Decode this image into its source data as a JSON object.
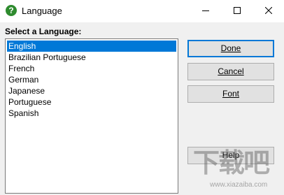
{
  "window": {
    "title": "Language",
    "icon": "question-mark-icon",
    "controls": [
      "minimize",
      "maximize",
      "close"
    ]
  },
  "prompt": "Select a Language:",
  "languages": [
    "English",
    "Brazilian Portuguese",
    "French",
    "German",
    "Japanese",
    "Portuguese",
    "Spanish"
  ],
  "selected_language": "English",
  "buttons": {
    "done": "Done",
    "cancel": "Cancel",
    "font": "Font",
    "help": "Help"
  },
  "watermark": {
    "text": "下载吧",
    "url": "www.xiazaiba.com"
  },
  "colors": {
    "selection": "#0078d7",
    "app_icon": "#2e8b2e",
    "dialog_background": "#f0f0f0"
  }
}
